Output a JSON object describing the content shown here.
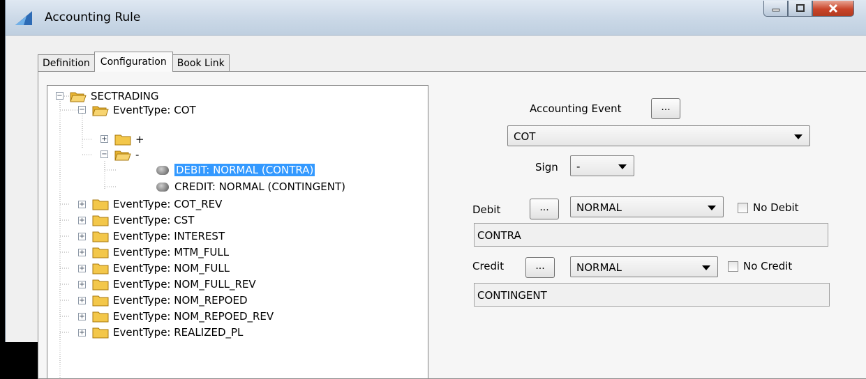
{
  "window": {
    "title": "Accounting Rule"
  },
  "tabs": [
    {
      "label": "Definition"
    },
    {
      "label": "Configuration"
    },
    {
      "label": "Book Link"
    }
  ],
  "tree": {
    "root": "SECTRADING",
    "expanded_event": "EventType: COT",
    "plus_folder": "+",
    "minus_folder": "-",
    "debit_leaf": "DEBIT: NORMAL (CONTRA)",
    "credit_leaf": "CREDIT: NORMAL (CONTINGENT)",
    "events": [
      "EventType: COT_REV",
      "EventType: CST",
      "EventType: INTEREST",
      "EventType: MTM_FULL",
      "EventType: NOM_FULL",
      "EventType: NOM_FULL_REV",
      "EventType: NOM_REPOED",
      "EventType: NOM_REPOED_REV",
      "EventType: REALIZED_PL"
    ]
  },
  "form": {
    "accounting_event_label": "Accounting Event",
    "dots": "...",
    "event_value": "COT",
    "sign_label": "Sign",
    "sign_value": "-",
    "debit_label": "Debit",
    "debit_value": "NORMAL",
    "no_debit_label": "No Debit",
    "debit_account": "CONTRA",
    "credit_label": "Credit",
    "credit_value": "NORMAL",
    "no_credit_label": "No Credit",
    "credit_account": "CONTINGENT"
  }
}
